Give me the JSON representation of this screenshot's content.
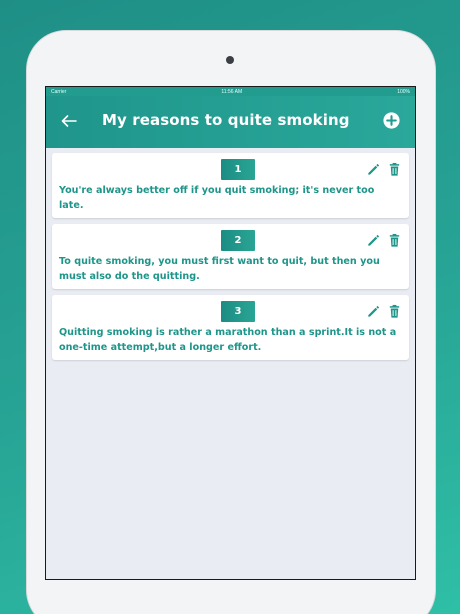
{
  "status_bar": {
    "carrier": "Carrier",
    "time": "11:56 AM",
    "battery": "100%"
  },
  "header": {
    "title": "My reasons to quite smoking"
  },
  "reasons": [
    {
      "number": "1",
      "text": "You're always better off if you quit smoking; it's never too late."
    },
    {
      "number": "2",
      "text": "To quite smoking, you must first want to quit, but then you must also do the quitting."
    },
    {
      "number": "3",
      "text": "Quitting smoking is rather a marathon than a sprint.It is not a one-time attempt,but a longer effort."
    }
  ],
  "colors": {
    "accent": "#239c90",
    "accent_light": "#2aa89a",
    "background": "#e9ecf3",
    "card": "#ffffff"
  },
  "icons": {
    "back": "arrow-left-icon",
    "add": "plus-circle-icon",
    "edit": "pencil-icon",
    "delete": "trash-icon"
  }
}
